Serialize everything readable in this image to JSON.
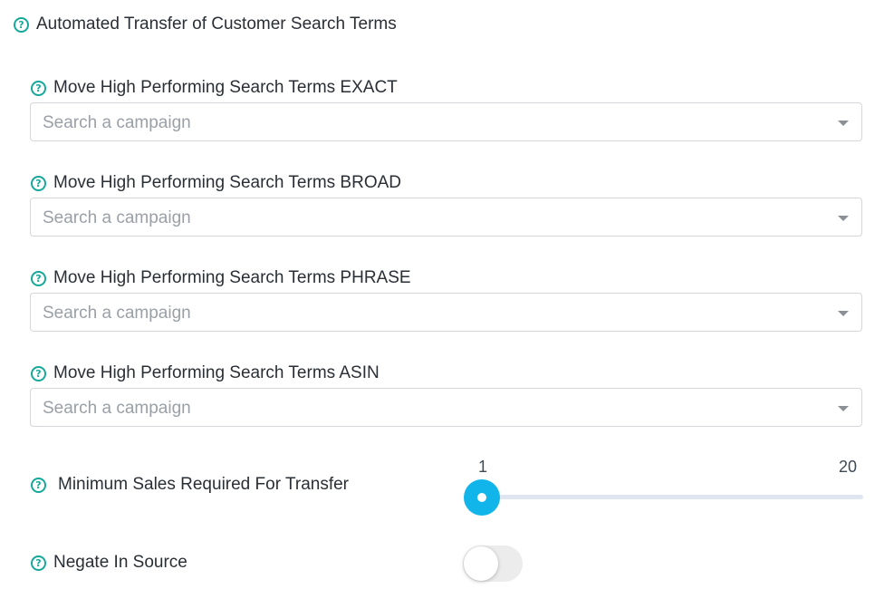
{
  "header": {
    "title": "Automated Transfer of Customer Search Terms",
    "help_icon": "question-circle-icon"
  },
  "fields": [
    {
      "label": "Move High Performing Search Terms EXACT",
      "placeholder": "Search a campaign",
      "value": ""
    },
    {
      "label": "Move High Performing Search Terms BROAD",
      "placeholder": "Search a campaign",
      "value": ""
    },
    {
      "label": "Move High Performing Search Terms PHRASE",
      "placeholder": "Search a campaign",
      "value": ""
    },
    {
      "label": "Move High Performing Search Terms ASIN",
      "placeholder": "Search a campaign",
      "value": ""
    }
  ],
  "slider": {
    "label": "Minimum Sales Required For Transfer",
    "min_label": "1",
    "max_label": "20",
    "min": 1,
    "max": 20,
    "value": 1
  },
  "toggle": {
    "label": "Negate In Source",
    "checked": false
  },
  "colors": {
    "accent": "#16a89a",
    "slider": "#12b5ea",
    "track": "#dfe6f2",
    "border": "#d4d7db"
  }
}
